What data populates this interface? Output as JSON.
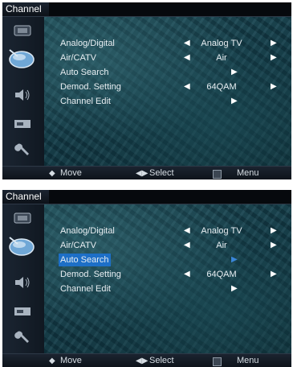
{
  "screens": [
    {
      "title": "Channel",
      "items": [
        {
          "label": "Analog/Digital",
          "value": "Analog TV",
          "left_arrow": "◀",
          "right_arrow": "▶",
          "selected": false
        },
        {
          "label": "Air/CATV",
          "value": "Air",
          "left_arrow": "◀",
          "right_arrow": "▶",
          "selected": false
        },
        {
          "label": "Auto Search",
          "value": "",
          "center_arrow": "▶",
          "selected": false
        },
        {
          "label": "Demod. Setting",
          "value": "64QAM",
          "left_arrow": "◀",
          "right_arrow": "▶",
          "selected": false
        },
        {
          "label": "Channel Edit",
          "value": "",
          "center_arrow": "▶",
          "selected": false
        }
      ],
      "footer": {
        "move": "Move",
        "select": "Select",
        "menu": "Menu"
      }
    },
    {
      "title": "Channel",
      "items": [
        {
          "label": "Analog/Digital",
          "value": "Analog TV",
          "left_arrow": "◀",
          "right_arrow": "▶",
          "selected": false
        },
        {
          "label": "Air/CATV",
          "value": "Air",
          "left_arrow": "◀",
          "right_arrow": "▶",
          "selected": false
        },
        {
          "label": "Auto Search",
          "value": "",
          "center_arrow": "▶",
          "selected": true
        },
        {
          "label": "Demod. Setting",
          "value": "64QAM",
          "left_arrow": "◀",
          "right_arrow": "▶",
          "selected": false
        },
        {
          "label": "Channel Edit",
          "value": "",
          "center_arrow": "▶",
          "selected": false
        }
      ],
      "footer": {
        "move": "Move",
        "select": "Select",
        "menu": "Menu"
      }
    }
  ],
  "sidebar_icons": [
    "picture-icon",
    "channel-dish-icon",
    "sound-icon",
    "input-icon",
    "setup-wrench-icon"
  ],
  "footer_icons": {
    "move": "◆",
    "select": "◀▶"
  },
  "colors": {
    "highlight": "#1d6fc7",
    "text": "#e8eef2",
    "bar": "#0d1219"
  }
}
